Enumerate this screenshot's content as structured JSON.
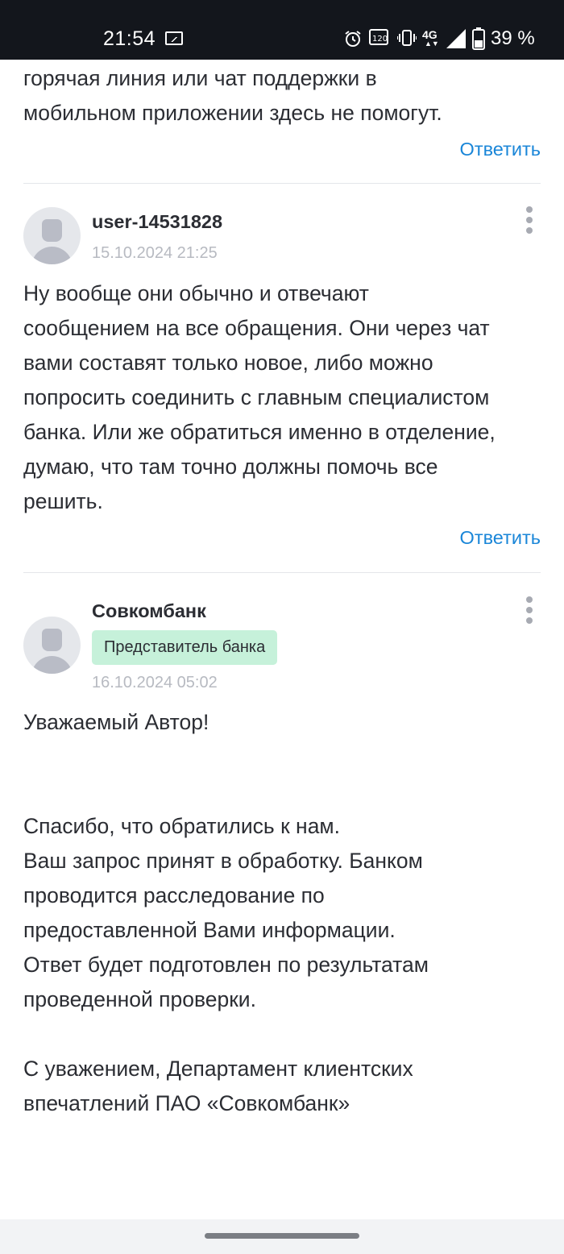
{
  "status_bar": {
    "time": "21:54",
    "network": "4G",
    "battery_percent": "39 %",
    "icons": [
      "gallery-icon",
      "alarm-icon",
      "refresh-rate-icon",
      "vibrate-icon",
      "network-icon",
      "signal-icon",
      "battery-icon"
    ],
    "refresh_rate_label": "120"
  },
  "colors": {
    "status_bar_bg": "#13161c",
    "link": "#1a86d8",
    "badge_bg": "#c6f1da",
    "muted": "#b7bac1"
  },
  "previous_comment": {
    "text_tail": "горячая линия или чат поддержки в\nмобильном приложении здесь не помогут.",
    "reply_label": "Ответить"
  },
  "comments": [
    {
      "author": "user-14531828",
      "date": "15.10.2024 21:25",
      "text": "Ну вообще они обычно и отвечают\nсообщением на все обращения. Они через чат\nвами составят только новое, либо можно\nпопросить соединить с главным специалистом\nбанка. Или же обратиться именно в отделение,\nдумаю, что там точно должны помочь все\nрешить.",
      "reply_label": "Ответить"
    },
    {
      "author": "Совкомбанк",
      "badge": "Представитель банка",
      "date": "16.10.2024 05:02",
      "text": "Уважаемый Автор!\n\n\nСпасибо, что обратились к нам.\nВаш запрос принят в обработку. Банком\nпроводится расследование по\nпредоставленной Вами информации.\nОтвет будет подготовлен по результатам\nпроведенной проверки.\n\nС уважением, Департамент клиентских\nвпечатлений ПАО «Совкомбанк»"
    }
  ]
}
